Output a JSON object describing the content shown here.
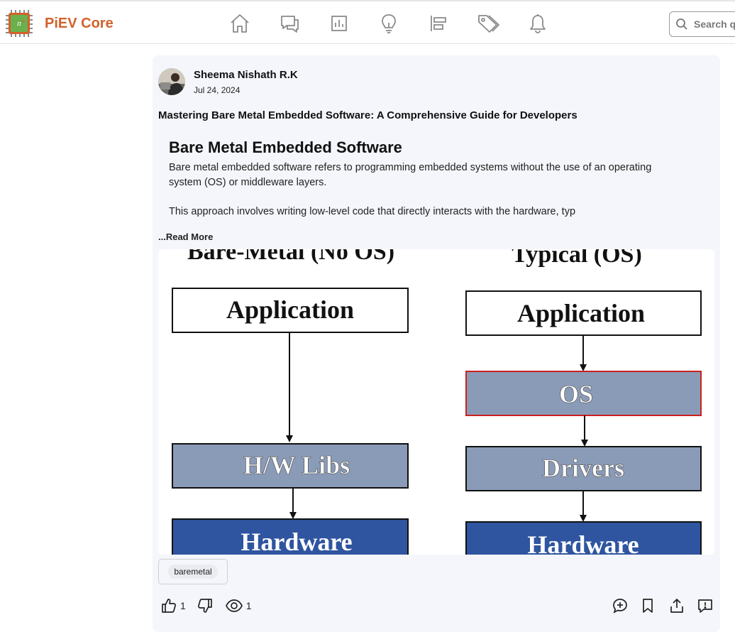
{
  "brand": {
    "name": "PiEV Core",
    "logo": "chip-logo"
  },
  "nav": [
    {
      "name": "nav-home",
      "icon": "home-icon"
    },
    {
      "name": "nav-discussions",
      "icon": "chat-icon"
    },
    {
      "name": "nav-stats",
      "icon": "bar-chart-icon"
    },
    {
      "name": "nav-ideas",
      "icon": "lightbulb-icon"
    },
    {
      "name": "nav-align",
      "icon": "align-icon"
    },
    {
      "name": "nav-tags",
      "icon": "tags-icon"
    },
    {
      "name": "nav-notifications",
      "icon": "bell-icon"
    }
  ],
  "search": {
    "placeholder": "Search qu"
  },
  "post": {
    "author": "Sheema Nishath R.K",
    "date": "Jul 24, 2024",
    "title": "Mastering Bare Metal Embedded Software: A Comprehensive Guide for Developers",
    "heading": "Bare Metal Embedded Software",
    "paragraph1": "Bare metal embedded software refers to programming embedded systems without the use of an operating system (OS) or middleware layers.",
    "paragraph2": "This approach involves writing low-level code that directly interacts with the hardware, typ",
    "read_more": "...Read More",
    "tag": "baremetal",
    "likes": "1",
    "views": "1"
  },
  "figure": {
    "left_title": "Bare-Metal (No OS)",
    "right_title": "Typical (OS)",
    "left_boxes": [
      "Application",
      "H/W Libs",
      "Hardware"
    ],
    "right_boxes": [
      "Application",
      "OS",
      "Drivers",
      "Hardware"
    ],
    "colors": {
      "white": "#ffffff",
      "grey": "#8a9bb7",
      "blue": "#2f55a0",
      "os_border": "#cc1f1f"
    }
  }
}
